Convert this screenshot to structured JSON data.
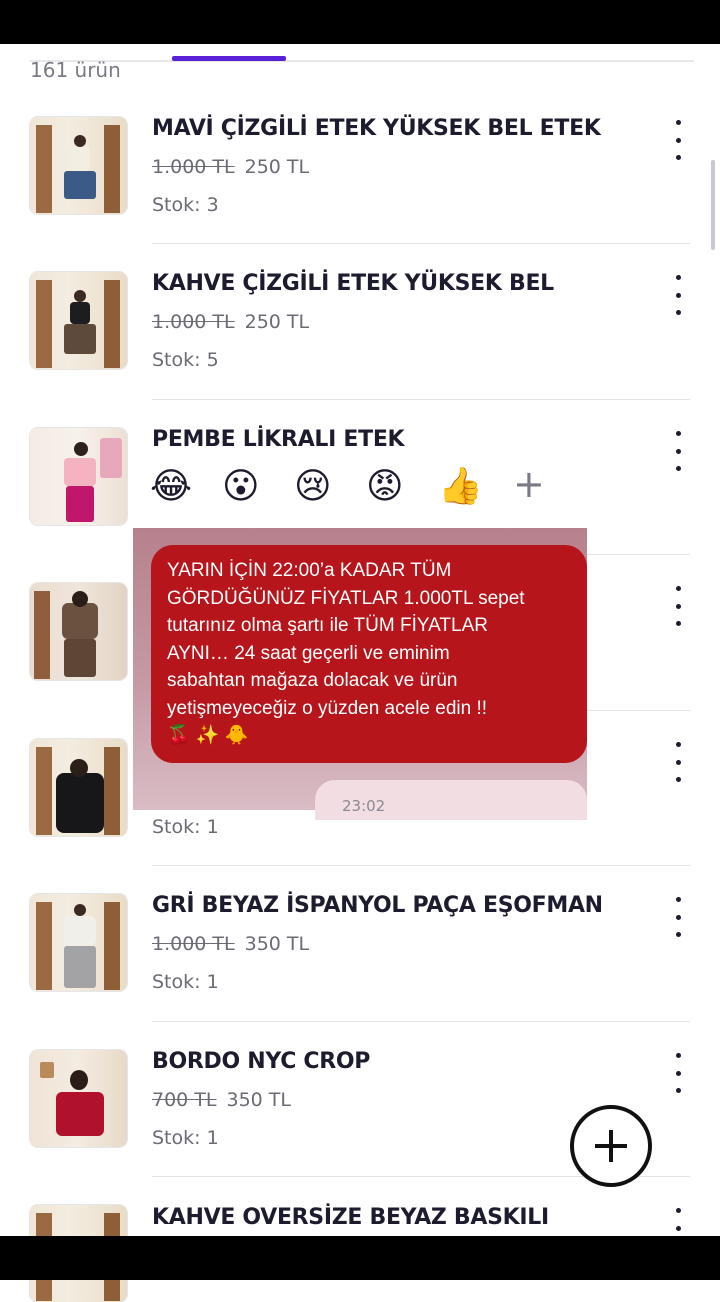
{
  "header": {
    "product_count": "161 ürün"
  },
  "products": [
    {
      "title": "MAVİ ÇİZGİLİ ETEK YÜKSEK BEL ETEK",
      "old_price": "1.000 TL",
      "price": "250 TL",
      "stock": "Stok: 3"
    },
    {
      "title": "KAHVE ÇİZGİLİ ETEK YÜKSEK BEL",
      "old_price": "1.000 TL",
      "price": "250 TL",
      "stock": "Stok: 5"
    },
    {
      "title": "PEMBE LİKRALI ETEK"
    },
    {
      "title": ""
    },
    {
      "stock": "Stok: 1"
    },
    {
      "title": "GRİ BEYAZ İSPANYOL PAÇA EŞOFMAN",
      "old_price": "1.000 TL",
      "price": "350 TL",
      "stock": "Stok: 1"
    },
    {
      "title": "BORDO NYC CROP",
      "old_price": "700 TL",
      "price": "350 TL",
      "stock": "Stok: 1"
    },
    {
      "title": "KAHVE OVERSİZE BEYAZ BASKILI"
    }
  ],
  "overlay": {
    "reactions": [
      "😂",
      "😮",
      "😢",
      "😡",
      "👍"
    ],
    "add_reaction": "+",
    "message_lines": [
      "YARIN İÇİN 22:00’a KADAR TÜM",
      "GÖRDÜĞÜNÜZ FİYATLAR 1.000TL sepet",
      "tutarınız olma şartı ile TÜM FİYATLAR",
      "AYNI… 24 saat geçerli ve eminim",
      "sabahtan mağaza dolacak ve ürün",
      "yetişmeyeceğiz o yüzden acele edin !!",
      "🍒 ✨ 🐥"
    ],
    "time": "23:02"
  },
  "fab": {
    "icon": "plus-icon"
  },
  "colors": {
    "accent": "#5a22d6",
    "message_bubble": "#b5151b"
  }
}
